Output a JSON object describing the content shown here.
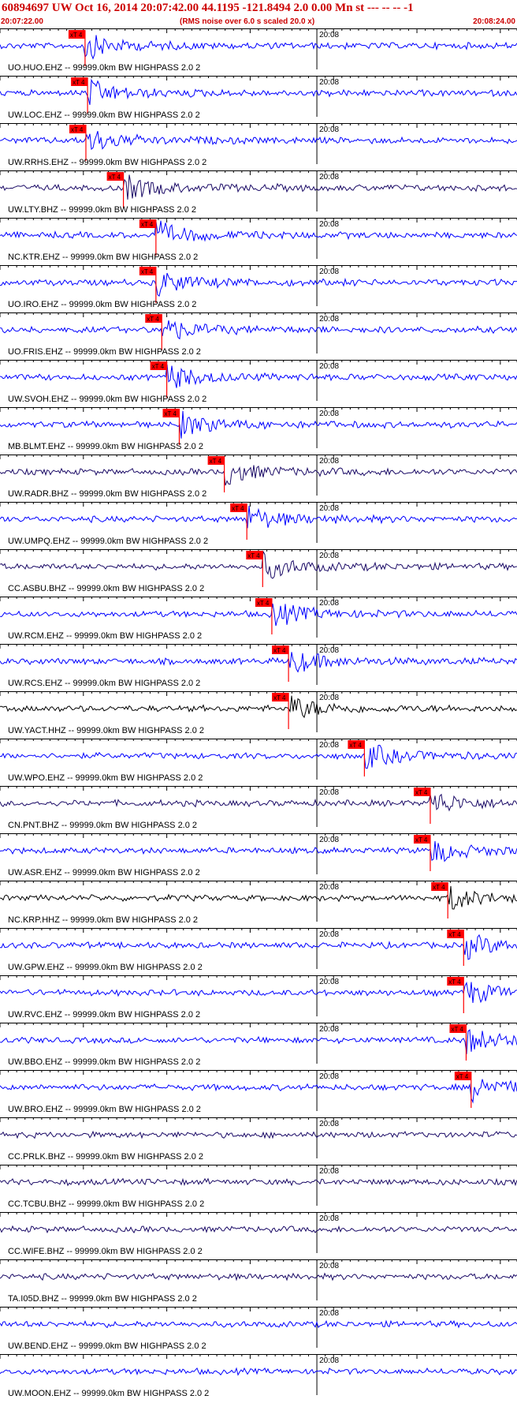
{
  "header": {
    "title": "60894697 UW Oct 16, 2014 20:07:42.00   44.1195 -121.8494  2.0 0.00 Mn st --- -- --   -1",
    "start_time": "20:07:22.00",
    "rms_note": "(RMS noise over 6.0 s scaled 20.0 x)",
    "end_time": "20:08:24.00"
  },
  "chart_data": {
    "type": "line",
    "x_range_seconds": [
      0,
      62
    ],
    "minute_tick_label": "20:08",
    "minute_tick_seconds": 38,
    "pick_label": "xT 4",
    "colors": {
      "blue": "#0000ff",
      "navy": "#1a0a66",
      "black": "#000000",
      "pick": "#ff0000"
    },
    "traces": [
      {
        "label": "UO.HUO.EHZ -- 99999.0km BW  HIGHPASS  2.0  2",
        "color": "blue",
        "pick_seconds": 10.2
      },
      {
        "label": "UW.LOC.EHZ -- 99999.0km BW  HIGHPASS  2.0  2",
        "color": "blue",
        "pick_seconds": 10.5
      },
      {
        "label": "UW.RRHS.EHZ -- 99999.0km BW  HIGHPASS  2.0  2",
        "color": "blue",
        "pick_seconds": 10.3
      },
      {
        "label": "UW.LTY.BHZ -- 99999.0km BW  HIGHPASS  2.0  2",
        "color": "navy",
        "pick_seconds": 14.8
      },
      {
        "label": "NC.KTR.EHZ -- 99999.0km BW  HIGHPASS  2.0  2",
        "color": "blue",
        "pick_seconds": 18.7
      },
      {
        "label": "UO.IRO.EHZ -- 99999.0km BW  HIGHPASS  2.0  2",
        "color": "blue",
        "pick_seconds": 18.7
      },
      {
        "label": "UO.FRIS.EHZ -- 99999.0km BW  HIGHPASS  2.0  2",
        "color": "blue",
        "pick_seconds": 19.4
      },
      {
        "label": "UW.SVOH.EHZ -- 99999.0km BW  HIGHPASS  2.0  2",
        "color": "blue",
        "pick_seconds": 20.0
      },
      {
        "label": "MB.BLMT.EHZ -- 99999.0km BW  HIGHPASS  2.0  2",
        "color": "blue",
        "pick_seconds": 21.5
      },
      {
        "label": "UW.RADR.BHZ -- 99999.0km BW  HIGHPASS  2.0  2",
        "color": "navy",
        "pick_seconds": 26.9
      },
      {
        "label": "UW.UMPQ.EHZ -- 99999.0km BW  HIGHPASS  2.0  2",
        "color": "blue",
        "pick_seconds": 29.6
      },
      {
        "label": "CC.ASBU.BHZ -- 99999.0km BW  HIGHPASS  2.0  2",
        "color": "navy",
        "pick_seconds": 31.5
      },
      {
        "label": "UW.RCM.EHZ -- 99999.0km BW  HIGHPASS  2.0  2",
        "color": "blue",
        "pick_seconds": 32.6
      },
      {
        "label": "UW.RCS.EHZ -- 99999.0km BW  HIGHPASS  2.0  2",
        "color": "blue",
        "pick_seconds": 34.6
      },
      {
        "label": "UW.YACT.HHZ -- 99999.0km BW  HIGHPASS  2.0  2",
        "color": "black",
        "pick_seconds": 34.6
      },
      {
        "label": "UW.WPO.EHZ -- 99999.0km BW  HIGHPASS  2.0  2",
        "color": "blue",
        "pick_seconds": 43.7
      },
      {
        "label": "CN.PNT.BHZ -- 99999.0km BW  HIGHPASS  2.0  2",
        "color": "navy",
        "pick_seconds": 51.6
      },
      {
        "label": "UW.ASR.EHZ -- 99999.0km BW  HIGHPASS  2.0  2",
        "color": "blue",
        "pick_seconds": 51.6
      },
      {
        "label": "NC.KRP.HHZ -- 99999.0km BW  HIGHPASS  2.0  2",
        "color": "black",
        "pick_seconds": 53.7
      },
      {
        "label": "UW.GPW.EHZ -- 99999.0km BW  HIGHPASS  2.0  2",
        "color": "blue",
        "pick_seconds": 55.6
      },
      {
        "label": "UW.RVC.EHZ -- 99999.0km BW  HIGHPASS  2.0  2",
        "color": "blue",
        "pick_seconds": 55.6
      },
      {
        "label": "UW.BBO.EHZ -- 99999.0km BW  HIGHPASS  2.0  2",
        "color": "blue",
        "pick_seconds": 55.9
      },
      {
        "label": "UW.BRO.EHZ -- 99999.0km BW  HIGHPASS  2.0  2",
        "color": "blue",
        "pick_seconds": 56.5
      },
      {
        "label": "CC.PRLK.BHZ -- 99999.0km BW  HIGHPASS  2.0  2",
        "color": "navy",
        "pick_seconds": null
      },
      {
        "label": "CC.TCBU.BHZ -- 99999.0km BW  HIGHPASS  2.0  2",
        "color": "navy",
        "pick_seconds": null
      },
      {
        "label": "CC.WIFE.BHZ -- 99999.0km BW  HIGHPASS  2.0  2",
        "color": "navy",
        "pick_seconds": null
      },
      {
        "label": "TA.I05D.BHZ -- 99999.0km BW  HIGHPASS  2.0  2",
        "color": "navy",
        "pick_seconds": null
      },
      {
        "label": "UW.BEND.EHZ -- 99999.0km BW  HIGHPASS  2.0  2",
        "color": "blue",
        "pick_seconds": null
      },
      {
        "label": "UW.MOON.EHZ -- 99999.0km BW  HIGHPASS  2.0  2",
        "color": "blue",
        "pick_seconds": null
      }
    ]
  }
}
